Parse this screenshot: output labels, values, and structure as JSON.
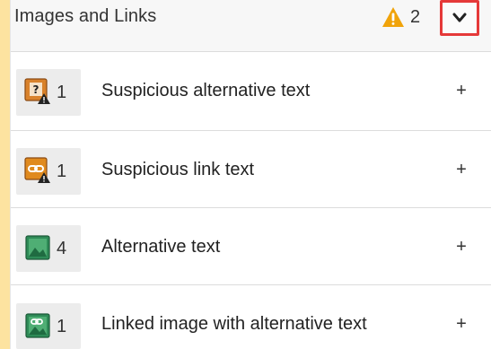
{
  "panel": {
    "title": "Images and Links",
    "warning_count": "2",
    "colors": {
      "accent": "#fde3a0",
      "warning": "#f0a30a",
      "collapse_border": "#e53939"
    }
  },
  "rows": [
    {
      "count": "1",
      "label": "Suspicious alternative text",
      "icon": "suspicious-alt-text-icon",
      "expand": "+"
    },
    {
      "count": "1",
      "label": "Suspicious link text",
      "icon": "suspicious-link-text-icon",
      "expand": "+"
    },
    {
      "count": "4",
      "label": "Alternative text",
      "icon": "alternative-text-image-icon",
      "expand": "+"
    },
    {
      "count": "1",
      "label": "Linked image with alternative text",
      "icon": "linked-image-icon",
      "expand": "+"
    }
  ]
}
